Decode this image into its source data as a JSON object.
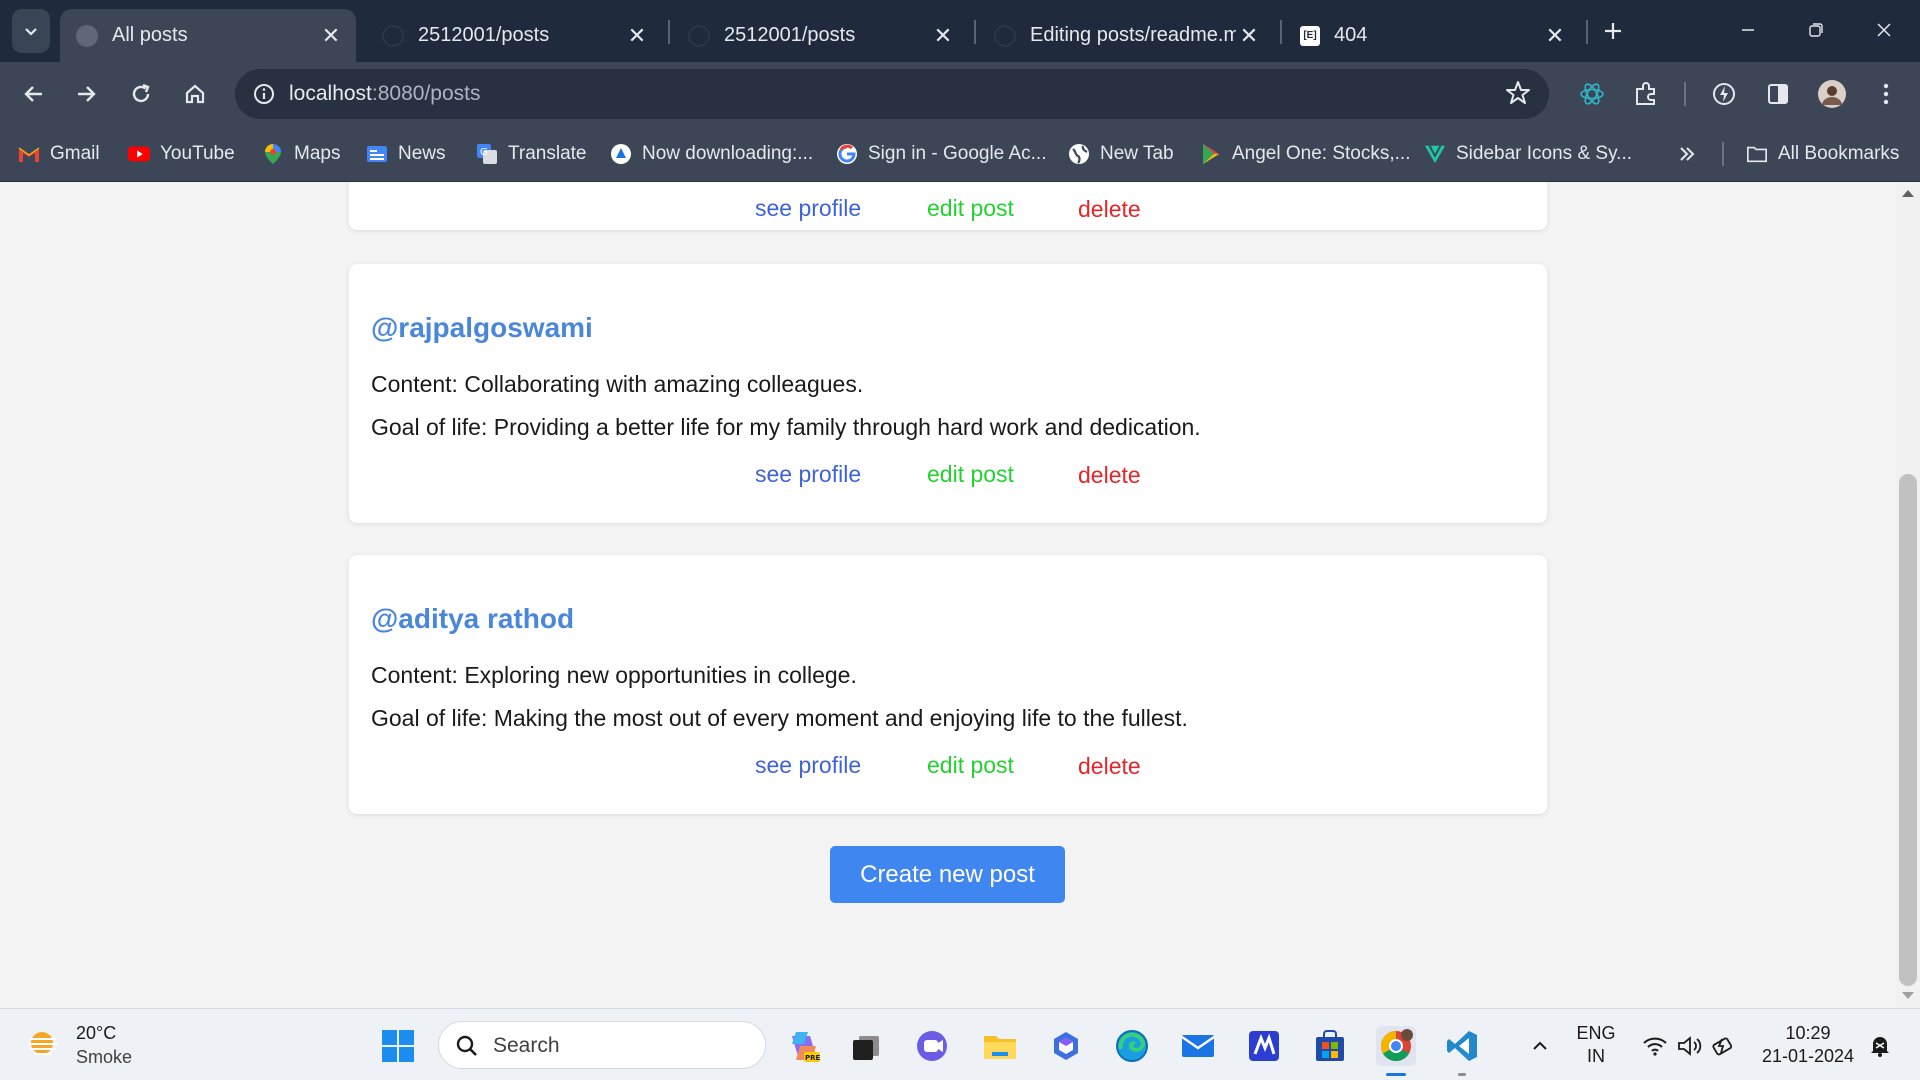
{
  "browser": {
    "tabs": [
      {
        "title": "All posts",
        "active": true
      },
      {
        "title": "2512001/posts",
        "active": false
      },
      {
        "title": "2512001/posts",
        "active": false
      },
      {
        "title": "Editing posts/readme.md",
        "active": false
      },
      {
        "title": "404",
        "active": false
      }
    ],
    "address": {
      "host": "localhost",
      "path": ":8080/posts"
    },
    "bookmarks": [
      {
        "label": "Gmail",
        "icon": "gmail-icon"
      },
      {
        "label": "YouTube",
        "icon": "youtube-icon"
      },
      {
        "label": "Maps",
        "icon": "maps-icon"
      },
      {
        "label": "News",
        "icon": "news-icon"
      },
      {
        "label": "Translate",
        "icon": "translate-icon"
      },
      {
        "label": "Now downloading:...",
        "icon": "download-icon"
      },
      {
        "label": "Sign in - Google Ac...",
        "icon": "google-icon"
      },
      {
        "label": "New Tab",
        "icon": "globe-icon"
      },
      {
        "label": "Angel One: Stocks,...",
        "icon": "play-store-icon"
      },
      {
        "label": "Sidebar Icons & Sy...",
        "icon": "sidebar-icons-icon"
      }
    ],
    "all_bookmarks": "All Bookmarks",
    "colors": {
      "tabstrip": "#1f2b3d",
      "toolbar": "#3c4657",
      "omnibox": "#273142"
    }
  },
  "posts": [
    {
      "username": "",
      "content": "",
      "goal": ""
    },
    {
      "username": "@rajpalgoswami",
      "content": "Content: Collaborating with amazing colleagues.",
      "goal": "Goal of life: Providing a better life for my family through hard work and dedication."
    },
    {
      "username": "@aditya rathod",
      "content": "Content: Exploring new opportunities in college.",
      "goal": "Goal of life: Making the most out of every moment and enjoying life to the fullest."
    }
  ],
  "actions": {
    "see_profile": "see profile",
    "edit_post": "edit post",
    "delete": "delete"
  },
  "create_button": "Create new post",
  "page_colors": {
    "link_blue": "#3f63d6",
    "edit_green": "#23d12f",
    "delete_red": "#e3262a",
    "username_blue": "#4a86d9",
    "button_blue": "#3f86f0"
  },
  "taskbar": {
    "weather": {
      "temp": "20°C",
      "desc": "Smoke"
    },
    "search_label": "Search",
    "lang": {
      "line1": "ENG",
      "line2": "IN"
    },
    "clock": {
      "time": "10:29",
      "date": "21-01-2024"
    }
  }
}
